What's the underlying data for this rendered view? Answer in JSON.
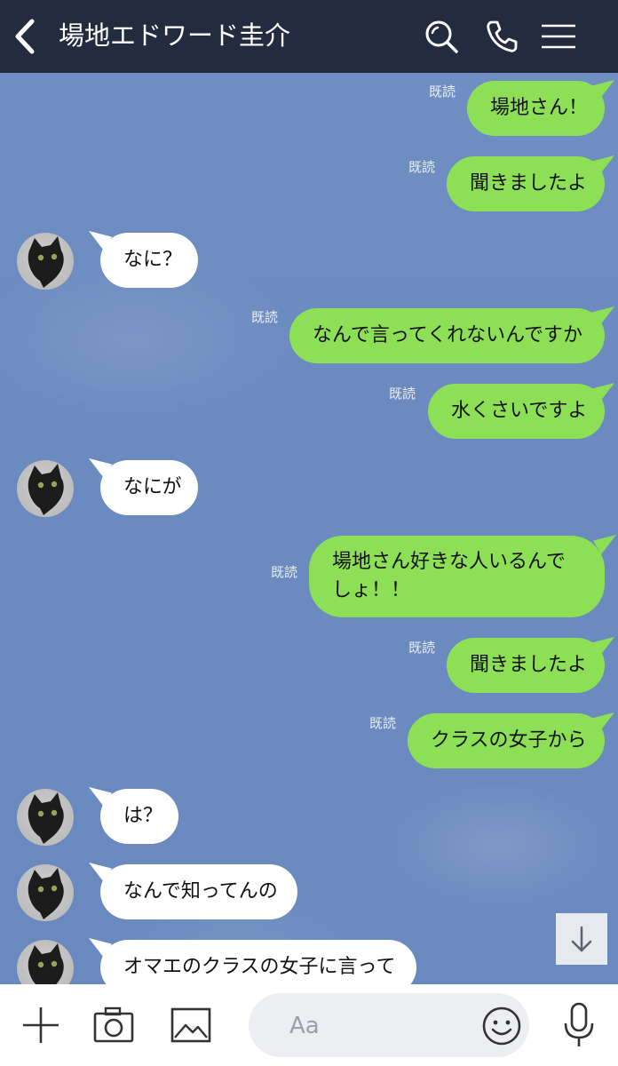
{
  "header": {
    "title": "場地エドワード圭介",
    "back_icon": "chevron-left-icon",
    "search_icon": "search-icon",
    "call_icon": "phone-icon",
    "menu_icon": "menu-icon"
  },
  "colors": {
    "header_bg": "#232b3f",
    "chat_bg": "#6b8ac0",
    "outgoing_bubble": "#8de055",
    "incoming_bubble": "#ffffff"
  },
  "messages": [
    {
      "direction": "out",
      "text": "場地さん！",
      "read": "既読"
    },
    {
      "direction": "out",
      "text": "聞きましたよ",
      "read": "既読"
    },
    {
      "direction": "in",
      "text": "なに？"
    },
    {
      "direction": "out",
      "text": "なんで言ってくれないんですか",
      "read": "既読"
    },
    {
      "direction": "out",
      "text": "水くさいですよ",
      "read": "既読"
    },
    {
      "direction": "in",
      "text": "なにが"
    },
    {
      "direction": "out",
      "text": "場地さん好きな人いるんでしょ！！",
      "read": "既読"
    },
    {
      "direction": "out",
      "text": "聞きましたよ",
      "read": "既読"
    },
    {
      "direction": "out",
      "text": "クラスの女子から",
      "read": "既読"
    },
    {
      "direction": "in",
      "text": "は？"
    },
    {
      "direction": "in",
      "text": "なんで知ってんの"
    },
    {
      "direction": "in",
      "text": "オマエのクラスの女子に言って"
    }
  ],
  "scroll_down_icon": "arrow-down-icon",
  "bottom_bar": {
    "plus_icon": "plus-icon",
    "camera_icon": "camera-icon",
    "image_icon": "image-icon",
    "input_placeholder": "Aa",
    "emoji_icon": "smiley-icon",
    "mic_icon": "microphone-icon"
  }
}
